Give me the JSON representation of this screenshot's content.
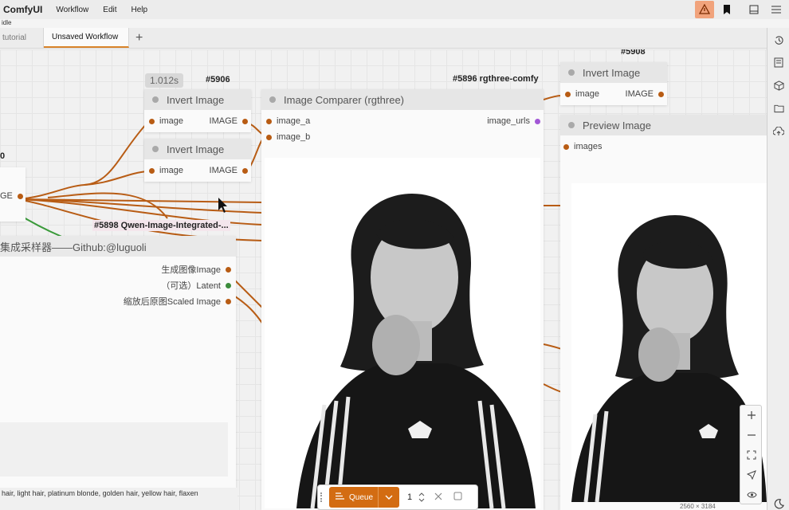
{
  "app": {
    "title": "ComfyUI",
    "status": "idle"
  },
  "menu": [
    "Workflow",
    "Edit",
    "Help"
  ],
  "tabs": {
    "inactive": "tutorial",
    "active": "Unsaved Workflow"
  },
  "nodes": {
    "invert1": {
      "title": "Invert Image",
      "id": "#5906",
      "time": "1.012s",
      "in_label": "image",
      "out_label": "IMAGE"
    },
    "invert2": {
      "title": "Invert Image",
      "in_label": "image",
      "out_label": "IMAGE"
    },
    "comparer": {
      "title": "Image Comparer (rgthree)",
      "id": "#5896 rgthree-comfy",
      "in1": "image_a",
      "in2": "image_b",
      "out": "image_urls"
    },
    "invert3": {
      "title": "Invert Image",
      "id": "#5908",
      "in_label": "image",
      "out_label": "IMAGE"
    },
    "preview": {
      "title": "Preview Image",
      "in_label": "images",
      "size_label": "2560 × 3184"
    },
    "qwen": {
      "id": "#5898 Qwen-Image-Integrated-...",
      "title": "集成采样器——Github:@luguoli",
      "out1": "生成图像Image",
      "out2": "（可选）Latent",
      "out3": "缩放后原图Scaled Image"
    },
    "left_partial": {
      "id": "0",
      "out": "GE"
    }
  },
  "prompt_text": "hair, light hair, platinum blonde, golden hair, yellow hair, flaxen",
  "queue": {
    "label": "Queue",
    "count": "1"
  },
  "colors": {
    "accent": "#d36c12",
    "link": "#b85c14"
  },
  "icons": [
    "history-icon",
    "list-icon",
    "cube-icon",
    "folder-icon",
    "upload-icon",
    "moon-icon"
  ]
}
